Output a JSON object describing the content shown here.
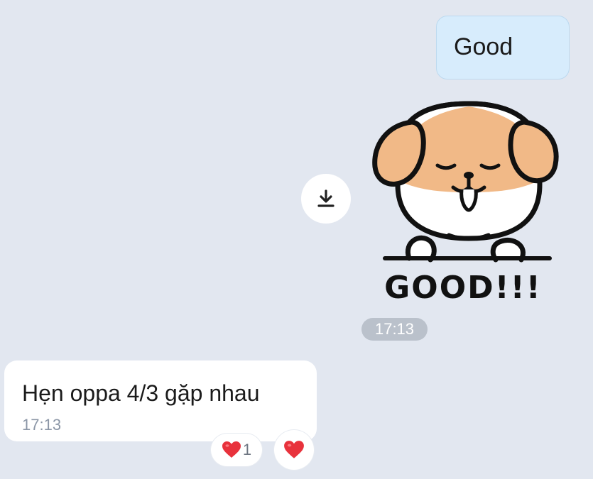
{
  "messages": {
    "outgoing_text": "Good",
    "sticker_text": "GOOD!!!",
    "sticker_time": "17:13",
    "incoming_text": "Hẹn oppa 4/3 gặp nhau",
    "incoming_time": "17:13"
  },
  "reactions": {
    "heart_count": "1"
  },
  "icons": {
    "download": "download-icon",
    "heart": "heart-icon"
  },
  "colors": {
    "background": "#e2e7f0",
    "outgoing_bubble": "#d7ecfc",
    "heart": "#e8323c",
    "sticker_ears": "#f1b987"
  }
}
